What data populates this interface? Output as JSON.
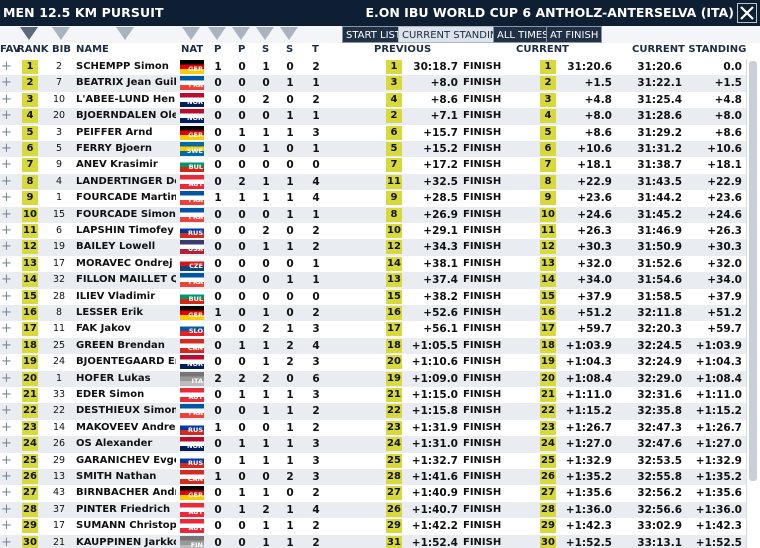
{
  "header": {
    "event": "MEN 12.5 KM PURSUIT",
    "competition": "E.ON IBU WORLD CUP 6 ANTHOLZ-ANTERSELVA (ITA)"
  },
  "buttons": {
    "start_list": "START LIST",
    "current_standing": "CURRENT STANDING",
    "all_times": "ALL TIMES",
    "at_finish": "AT FINISH"
  },
  "columns": {
    "fav": "FAV",
    "rank": "RANK",
    "bib": "BIB",
    "name": "NAME",
    "nat": "NAT",
    "p1": "P",
    "p2": "P",
    "s1": "S",
    "s2": "S",
    "t": "T",
    "previous": "PREVIOUS",
    "current": "CURRENT",
    "current_standing": "CURRENT STANDING"
  },
  "fav_glyph": "+",
  "colors": {
    "accent": "#d7da3a",
    "header_bg": "#0e1e33",
    "button_active": "#203047"
  },
  "nat_flags": {
    "GER": [
      "#000000",
      "#dd0000",
      "#ffcc00"
    ],
    "FRA": [
      "#0055a4",
      "#ffffff",
      "#ef4135"
    ],
    "NOR": [
      "#ba0c2f",
      "#ffffff",
      "#00205b"
    ],
    "SWE": [
      "#006aa7",
      "#fecc00",
      "#006aa7"
    ],
    "BUL": [
      "#ffffff",
      "#00966e",
      "#d62612"
    ],
    "AUT": [
      "#ed2939",
      "#ffffff",
      "#ed2939"
    ],
    "RUS": [
      "#ffffff",
      "#0039a6",
      "#d52b1e"
    ],
    "USA": [
      "#3c3b6e",
      "#ffffff",
      "#b22234"
    ],
    "CZE": [
      "#ffffff",
      "#d7141a",
      "#11457e"
    ],
    "SLO": [
      "#ffffff",
      "#005da4",
      "#ed1c24"
    ],
    "CAN": [
      "#d52b1e",
      "#ffffff",
      "#d52b1e"
    ]
  },
  "rows": [
    {
      "rank": "1",
      "bib": "2",
      "name": "SCHEMPP Simon",
      "nat": "GER",
      "p1": "1",
      "p2": "0",
      "s1": "1",
      "s2": "0",
      "t": "2",
      "prev_rank": "1",
      "prev_time": "30:18.7",
      "prev_status": "FINISH",
      "cur_rank": "1",
      "cur_time": "31:20.6",
      "stand_time": "31:20.6",
      "stand_diff": "0.0"
    },
    {
      "rank": "2",
      "bib": "7",
      "name": "BEATRIX Jean Guillaume",
      "nat": "FRA",
      "p1": "0",
      "p2": "0",
      "s1": "0",
      "s2": "1",
      "t": "1",
      "prev_rank": "3",
      "prev_time": "+8.0",
      "prev_status": "FINISH",
      "cur_rank": "2",
      "cur_time": "+1.5",
      "stand_time": "31:22.1",
      "stand_diff": "+1.5"
    },
    {
      "rank": "3",
      "bib": "10",
      "name": "L'ABEE-LUND Henrik",
      "nat": "NOR",
      "p1": "0",
      "p2": "0",
      "s1": "2",
      "s2": "0",
      "t": "2",
      "prev_rank": "4",
      "prev_time": "+8.6",
      "prev_status": "FINISH",
      "cur_rank": "3",
      "cur_time": "+4.8",
      "stand_time": "31:25.4",
      "stand_diff": "+4.8"
    },
    {
      "rank": "4",
      "bib": "20",
      "name": "BJOERNDALEN Ole Einar",
      "nat": "NOR",
      "p1": "0",
      "p2": "0",
      "s1": "0",
      "s2": "1",
      "t": "1",
      "prev_rank": "2",
      "prev_time": "+7.1",
      "prev_status": "FINISH",
      "cur_rank": "4",
      "cur_time": "+8.0",
      "stand_time": "31:28.6",
      "stand_diff": "+8.0"
    },
    {
      "rank": "5",
      "bib": "3",
      "name": "PEIFFER Arnd",
      "nat": "GER",
      "p1": "0",
      "p2": "1",
      "s1": "1",
      "s2": "1",
      "t": "3",
      "prev_rank": "6",
      "prev_time": "+15.7",
      "prev_status": "FINISH",
      "cur_rank": "5",
      "cur_time": "+8.6",
      "stand_time": "31:29.2",
      "stand_diff": "+8.6"
    },
    {
      "rank": "6",
      "bib": "5",
      "name": "FERRY Bjoern",
      "nat": "SWE",
      "p1": "0",
      "p2": "0",
      "s1": "1",
      "s2": "0",
      "t": "1",
      "prev_rank": "5",
      "prev_time": "+15.2",
      "prev_status": "FINISH",
      "cur_rank": "6",
      "cur_time": "+10.6",
      "stand_time": "31:31.2",
      "stand_diff": "+10.6"
    },
    {
      "rank": "7",
      "bib": "9",
      "name": "ANEV Krasimir",
      "nat": "BUL",
      "p1": "0",
      "p2": "0",
      "s1": "0",
      "s2": "0",
      "t": "0",
      "prev_rank": "7",
      "prev_time": "+17.2",
      "prev_status": "FINISH",
      "cur_rank": "7",
      "cur_time": "+18.1",
      "stand_time": "31:38.7",
      "stand_diff": "+18.1"
    },
    {
      "rank": "8",
      "bib": "4",
      "name": "LANDERTINGER Dominik",
      "nat": "AUT",
      "p1": "0",
      "p2": "2",
      "s1": "1",
      "s2": "1",
      "t": "4",
      "prev_rank": "11",
      "prev_time": "+32.5",
      "prev_status": "FINISH",
      "cur_rank": "8",
      "cur_time": "+22.9",
      "stand_time": "31:43.5",
      "stand_diff": "+22.9"
    },
    {
      "rank": "9",
      "bib": "1",
      "name": "FOURCADE Martin",
      "nat": "FRA",
      "p1": "1",
      "p2": "1",
      "s1": "1",
      "s2": "1",
      "t": "4",
      "prev_rank": "9",
      "prev_time": "+28.5",
      "prev_status": "FINISH",
      "cur_rank": "9",
      "cur_time": "+23.6",
      "stand_time": "31:44.2",
      "stand_diff": "+23.6"
    },
    {
      "rank": "10",
      "bib": "15",
      "name": "FOURCADE Simon",
      "nat": "FRA",
      "p1": "0",
      "p2": "0",
      "s1": "0",
      "s2": "1",
      "t": "1",
      "prev_rank": "8",
      "prev_time": "+26.9",
      "prev_status": "FINISH",
      "cur_rank": "10",
      "cur_time": "+24.6",
      "stand_time": "31:45.2",
      "stand_diff": "+24.6"
    },
    {
      "rank": "11",
      "bib": "6",
      "name": "LAPSHIN Timofey",
      "nat": "RUS",
      "p1": "0",
      "p2": "0",
      "s1": "2",
      "s2": "0",
      "t": "2",
      "prev_rank": "10",
      "prev_time": "+29.1",
      "prev_status": "FINISH",
      "cur_rank": "11",
      "cur_time": "+26.3",
      "stand_time": "31:46.9",
      "stand_diff": "+26.3"
    },
    {
      "rank": "12",
      "bib": "19",
      "name": "BAILEY Lowell",
      "nat": "USA",
      "p1": "0",
      "p2": "0",
      "s1": "1",
      "s2": "1",
      "t": "2",
      "prev_rank": "12",
      "prev_time": "+34.3",
      "prev_status": "FINISH",
      "cur_rank": "12",
      "cur_time": "+30.3",
      "stand_time": "31:50.9",
      "stand_diff": "+30.3"
    },
    {
      "rank": "13",
      "bib": "17",
      "name": "MORAVEC Ondrej",
      "nat": "CZE",
      "p1": "0",
      "p2": "0",
      "s1": "0",
      "s2": "0",
      "t": "1",
      "prev_rank": "14",
      "prev_time": "+38.1",
      "prev_status": "FINISH",
      "cur_rank": "13",
      "cur_time": "+32.0",
      "stand_time": "31:52.6",
      "stand_diff": "+32.0"
    },
    {
      "rank": "14",
      "bib": "32",
      "name": "FILLON MAILLET Quentin",
      "nat": "FRA",
      "p1": "0",
      "p2": "0",
      "s1": "0",
      "s2": "1",
      "t": "1",
      "prev_rank": "13",
      "prev_time": "+37.4",
      "prev_status": "FINISH",
      "cur_rank": "14",
      "cur_time": "+34.0",
      "stand_time": "31:54.6",
      "stand_diff": "+34.0"
    },
    {
      "rank": "15",
      "bib": "28",
      "name": "ILIEV Vladimir",
      "nat": "BUL",
      "p1": "0",
      "p2": "0",
      "s1": "0",
      "s2": "0",
      "t": "0",
      "prev_rank": "15",
      "prev_time": "+38.2",
      "prev_status": "FINISH",
      "cur_rank": "15",
      "cur_time": "+37.9",
      "stand_time": "31:58.5",
      "stand_diff": "+37.9"
    },
    {
      "rank": "16",
      "bib": "8",
      "name": "LESSER Erik",
      "nat": "GER",
      "p1": "1",
      "p2": "0",
      "s1": "1",
      "s2": "0",
      "t": "2",
      "prev_rank": "16",
      "prev_time": "+52.6",
      "prev_status": "FINISH",
      "cur_rank": "16",
      "cur_time": "+51.2",
      "stand_time": "32:11.8",
      "stand_diff": "+51.2"
    },
    {
      "rank": "17",
      "bib": "11",
      "name": "FAK Jakov",
      "nat": "SLO",
      "p1": "0",
      "p2": "0",
      "s1": "2",
      "s2": "1",
      "t": "3",
      "prev_rank": "17",
      "prev_time": "+56.1",
      "prev_status": "FINISH",
      "cur_rank": "17",
      "cur_time": "+59.7",
      "stand_time": "32:20.3",
      "stand_diff": "+59.7"
    },
    {
      "rank": "18",
      "bib": "25",
      "name": "GREEN Brendan",
      "nat": "CAN",
      "p1": "0",
      "p2": "1",
      "s1": "1",
      "s2": "2",
      "t": "4",
      "prev_rank": "18",
      "prev_time": "+1:05.5",
      "prev_status": "FINISH",
      "cur_rank": "18",
      "cur_time": "+1:03.9",
      "stand_time": "32:24.5",
      "stand_diff": "+1:03.9"
    },
    {
      "rank": "19",
      "bib": "24",
      "name": "BJOENTEGAARD Erlend",
      "nat": "NOR",
      "p1": "0",
      "p2": "0",
      "s1": "1",
      "s2": "2",
      "t": "3",
      "prev_rank": "20",
      "prev_time": "+1:10.6",
      "prev_status": "FINISH",
      "cur_rank": "19",
      "cur_time": "+1:04.3",
      "stand_time": "32:24.9",
      "stand_diff": "+1:04.3"
    },
    {
      "rank": "20",
      "bib": "1",
      "name": "HOFER Lukas",
      "nat": "ITA",
      "p1": "2",
      "p2": "2",
      "s1": "2",
      "s2": "0",
      "t": "6",
      "prev_rank": "19",
      "prev_time": "+1:09.0",
      "prev_status": "FINISH",
      "cur_rank": "20",
      "cur_time": "+1:08.4",
      "stand_time": "32:29.0",
      "stand_diff": "+1:08.4"
    },
    {
      "rank": "21",
      "bib": "33",
      "name": "EDER Simon",
      "nat": "AUT",
      "p1": "0",
      "p2": "1",
      "s1": "1",
      "s2": "1",
      "t": "3",
      "prev_rank": "21",
      "prev_time": "+1:15.0",
      "prev_status": "FINISH",
      "cur_rank": "21",
      "cur_time": "+1:11.0",
      "stand_time": "32:31.6",
      "stand_diff": "+1:11.0"
    },
    {
      "rank": "22",
      "bib": "22",
      "name": "DESTHIEUX Simon",
      "nat": "FRA",
      "p1": "0",
      "p2": "0",
      "s1": "1",
      "s2": "1",
      "t": "2",
      "prev_rank": "22",
      "prev_time": "+1:15.8",
      "prev_status": "FINISH",
      "cur_rank": "22",
      "cur_time": "+1:15.2",
      "stand_time": "32:35.8",
      "stand_diff": "+1:15.2"
    },
    {
      "rank": "23",
      "bib": "14",
      "name": "MAKOVEEV Andrei",
      "nat": "RUS",
      "p1": "1",
      "p2": "0",
      "s1": "0",
      "s2": "1",
      "t": "2",
      "prev_rank": "23",
      "prev_time": "+1:31.9",
      "prev_status": "FINISH",
      "cur_rank": "23",
      "cur_time": "+1:26.7",
      "stand_time": "32:47.3",
      "stand_diff": "+1:26.7"
    },
    {
      "rank": "24",
      "bib": "26",
      "name": "OS Alexander",
      "nat": "NOR",
      "p1": "0",
      "p2": "1",
      "s1": "1",
      "s2": "1",
      "t": "3",
      "prev_rank": "24",
      "prev_time": "+1:31.0",
      "prev_status": "FINISH",
      "cur_rank": "24",
      "cur_time": "+1:27.0",
      "stand_time": "32:47.6",
      "stand_diff": "+1:27.0"
    },
    {
      "rank": "25",
      "bib": "29",
      "name": "GARANICHEV Evgeniy",
      "nat": "RUS",
      "p1": "0",
      "p2": "1",
      "s1": "1",
      "s2": "1",
      "t": "3",
      "prev_rank": "25",
      "prev_time": "+1:32.7",
      "prev_status": "FINISH",
      "cur_rank": "25",
      "cur_time": "+1:32.9",
      "stand_time": "32:53.5",
      "stand_diff": "+1:32.9"
    },
    {
      "rank": "26",
      "bib": "13",
      "name": "SMITH Nathan",
      "nat": "CAN",
      "p1": "1",
      "p2": "0",
      "s1": "0",
      "s2": "2",
      "t": "3",
      "prev_rank": "28",
      "prev_time": "+1:41.6",
      "prev_status": "FINISH",
      "cur_rank": "26",
      "cur_time": "+1:35.2",
      "stand_time": "32:55.8",
      "stand_diff": "+1:35.2"
    },
    {
      "rank": "27",
      "bib": "43",
      "name": "BIRNBACHER Andreas",
      "nat": "GER",
      "p1": "0",
      "p2": "1",
      "s1": "1",
      "s2": "0",
      "t": "2",
      "prev_rank": "27",
      "prev_time": "+1:40.9",
      "prev_status": "FINISH",
      "cur_rank": "27",
      "cur_time": "+1:35.6",
      "stand_time": "32:56.2",
      "stand_diff": "+1:35.6"
    },
    {
      "rank": "28",
      "bib": "37",
      "name": "PINTER Friedrich",
      "nat": "AUT",
      "p1": "0",
      "p2": "1",
      "s1": "2",
      "s2": "1",
      "t": "4",
      "prev_rank": "26",
      "prev_time": "+1:40.7",
      "prev_status": "FINISH",
      "cur_rank": "28",
      "cur_time": "+1:36.0",
      "stand_time": "32:56.6",
      "stand_diff": "+1:36.0"
    },
    {
      "rank": "29",
      "bib": "17",
      "name": "SUMANN Christoph",
      "nat": "AUT",
      "p1": "0",
      "p2": "0",
      "s1": "1",
      "s2": "1",
      "t": "2",
      "prev_rank": "29",
      "prev_time": "+1:42.2",
      "prev_status": "FINISH",
      "cur_rank": "29",
      "cur_time": "+1:42.3",
      "stand_time": "33:02.9",
      "stand_diff": "+1:42.3"
    },
    {
      "rank": "30",
      "bib": "21",
      "name": "KAUPPINEN Jarkko",
      "nat": "FIN",
      "p1": "0",
      "p2": "0",
      "s1": "1",
      "s2": "1",
      "t": "2",
      "prev_rank": "31",
      "prev_time": "+1:52.4",
      "prev_status": "FINISH",
      "cur_rank": "30",
      "cur_time": "+1:52.5",
      "stand_time": "33:13.1",
      "stand_diff": "+1:52.5"
    }
  ]
}
